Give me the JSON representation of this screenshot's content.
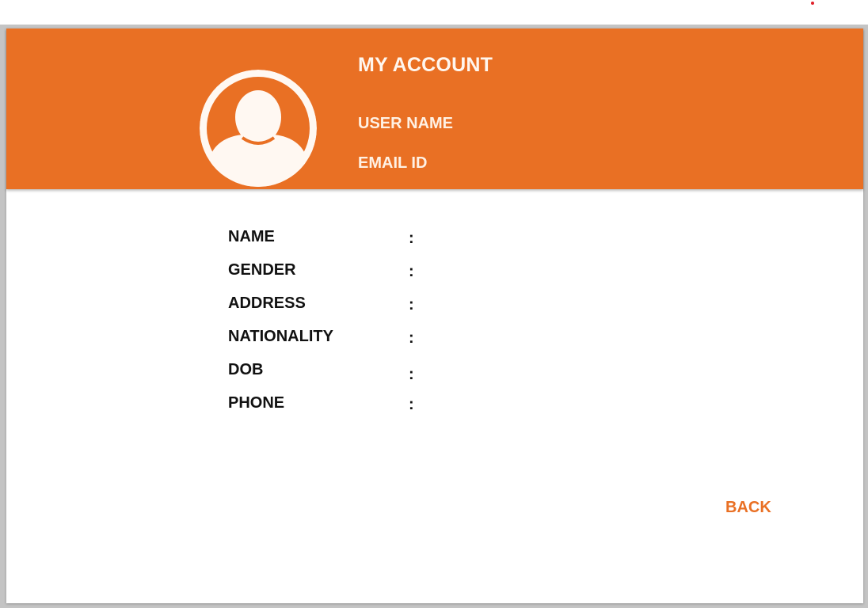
{
  "colors": {
    "accent": "#e97024",
    "header_text": "#fff6ee",
    "avatar_fill": "#fff8f2",
    "indicator_dot": "#e0202a"
  },
  "header": {
    "title": "MY ACCOUNT",
    "user_name": "USER NAME",
    "email_id": "EMAIL ID",
    "avatar_icon": "user-avatar-icon"
  },
  "details": {
    "rows": [
      {
        "label": "NAME",
        "separator": ":"
      },
      {
        "label": "GENDER",
        "separator": ":"
      },
      {
        "label": "ADDRESS",
        "separator": ":"
      },
      {
        "label": "NATIONALITY",
        "separator": ":"
      },
      {
        "label": "DOB",
        "separator": ":"
      },
      {
        "label": "PHONE",
        "separator": ":"
      }
    ]
  },
  "actions": {
    "back_label": "BACK"
  }
}
